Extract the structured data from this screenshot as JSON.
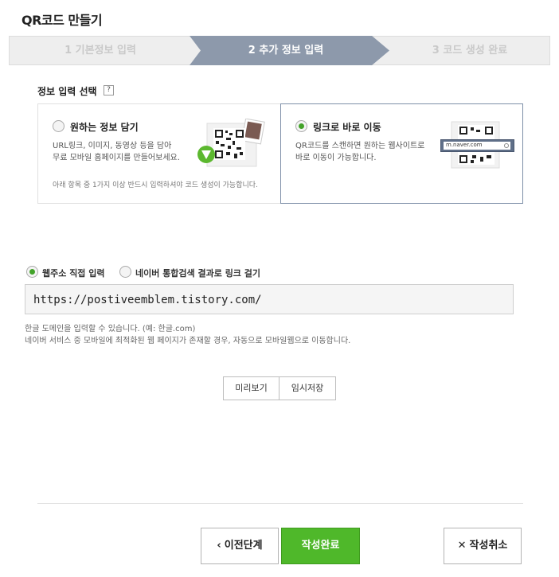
{
  "page": {
    "title": "QR코드 만들기"
  },
  "steps": [
    {
      "label": "1  기본정보 입력",
      "state": "done"
    },
    {
      "label": "2  추가 정보 입력",
      "state": "active"
    },
    {
      "label": "3  코드 생성 완료",
      "state": "pending"
    }
  ],
  "section": {
    "label": "정보 입력 선택",
    "help": "?"
  },
  "options": {
    "info": {
      "title": "원하는 정보 담기",
      "desc_line1": "URL링크, 이미지, 동영상 등을 담아",
      "desc_line2": "무료 모바일 홈페이지를 만들어보세요.",
      "note": "아래 항목 중 1가지 이상 반드시 입력하셔야 코드 생성이 가능합니다.",
      "selected": false
    },
    "link": {
      "title": "링크로 바로 이동",
      "desc_line1": "QR코드를 스캔하면 원하는 웹사이트로",
      "desc_line2": "바로 이동이 가능합니다.",
      "browser_url": "m.naver.com",
      "selected": true
    }
  },
  "url_mode": {
    "direct": {
      "label": "웹주소 직접 입력",
      "selected": true
    },
    "search": {
      "label": "네이버 통합검색 결과로 링크 걸기",
      "selected": false
    }
  },
  "url_input": {
    "value": "https://postiveemblem.tistory.com/"
  },
  "hints": {
    "line1": "한글 도메인을 입력할 수 있습니다. (예: 한글.com)",
    "line2": "네이버 서비스 중 모바일에 최적화된 웹 페이지가 존재할 경우, 자동으로 모바일웹으로 이동합니다."
  },
  "actions": {
    "preview": "미리보기",
    "temp_save": "임시저장",
    "prev": "이전단계",
    "done": "작성완료",
    "cancel": "작성취소"
  },
  "colors": {
    "active_step": "#8d99ab",
    "accent_green": "#4fb82a",
    "selected_border": "#7d8fa8"
  }
}
